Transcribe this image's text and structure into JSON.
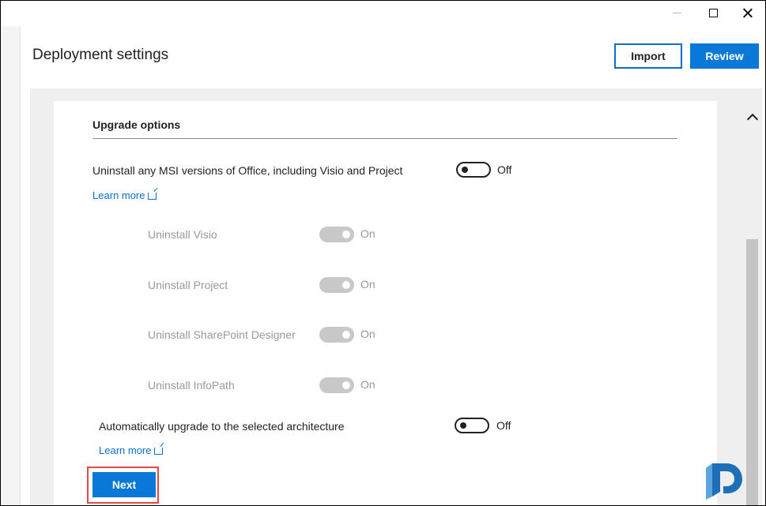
{
  "window": {
    "minimize_icon": "minimize-icon",
    "maximize_icon": "maximize-icon",
    "close_icon": "close-icon"
  },
  "header": {
    "title": "Deployment settings",
    "import_label": "Import",
    "review_label": "Review"
  },
  "section": {
    "title": "Upgrade options"
  },
  "msi": {
    "label": "Uninstall any MSI versions of Office, including Visio and Project",
    "state": "Off",
    "learn_more": "Learn more"
  },
  "sub_options": [
    {
      "label": "Uninstall Visio",
      "state": "On"
    },
    {
      "label": "Uninstall Project",
      "state": "On"
    },
    {
      "label": "Uninstall SharePoint Designer",
      "state": "On"
    },
    {
      "label": "Uninstall InfoPath",
      "state": "On"
    }
  ],
  "arch": {
    "label": "Automatically upgrade to the selected architecture",
    "state": "Off",
    "learn_more": "Learn more"
  },
  "footer": {
    "next_label": "Next"
  },
  "colors": {
    "accent": "#0a78d7",
    "highlight": "#e24848",
    "disabled_toggle": "#c8c8c8"
  }
}
